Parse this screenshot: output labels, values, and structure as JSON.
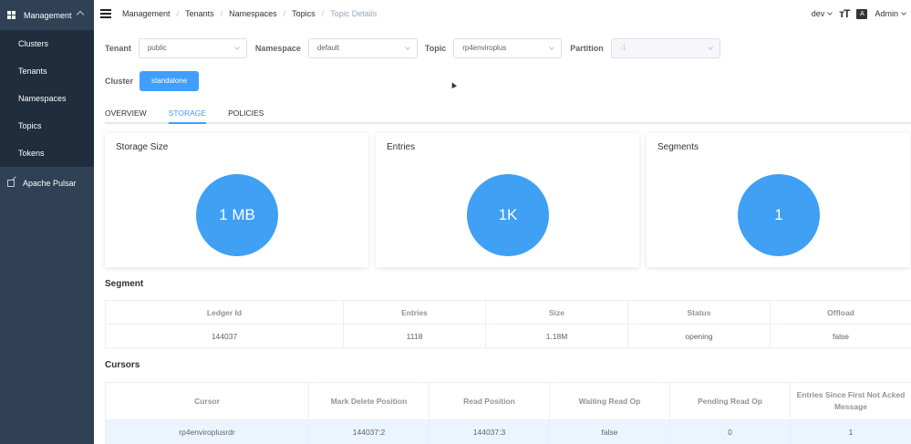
{
  "sidebar": {
    "header": "Management",
    "items": [
      {
        "label": "Clusters"
      },
      {
        "label": "Tenants"
      },
      {
        "label": "Namespaces"
      },
      {
        "label": "Topics"
      },
      {
        "label": "Tokens"
      }
    ],
    "external": "Apache Pulsar"
  },
  "topbar": {
    "breadcrumbs": [
      "Management",
      "Tenants",
      "Namespaces",
      "Topics",
      "Topic Details"
    ],
    "env": "dev",
    "user": "Admin",
    "lang_icon_text": "A"
  },
  "filters": {
    "tenant_label": "Tenant",
    "tenant_value": "public",
    "namespace_label": "Namespace",
    "namespace_value": "default",
    "topic_label": "Topic",
    "topic_value": "rp4enviroplus",
    "partition_label": "Partition",
    "partition_value": "-1",
    "cluster_label": "Cluster",
    "cluster_value": "standalone"
  },
  "tabs": [
    "OVERVIEW",
    "STORAGE",
    "POLICIES"
  ],
  "cards": [
    {
      "title": "Storage Size",
      "value": "1 MB"
    },
    {
      "title": "Entries",
      "value": "1K"
    },
    {
      "title": "Segments",
      "value": "1"
    }
  ],
  "segment": {
    "title": "Segment",
    "columns": [
      "Ledger Id",
      "Entries",
      "Size",
      "Status",
      "Offload"
    ],
    "rows": [
      [
        "144037",
        "1118",
        "1.18M",
        "opening",
        "false"
      ]
    ]
  },
  "cursors": {
    "title": "Cursors",
    "columns": [
      "Cursor",
      "Mark Delete Position",
      "Read Position",
      "Waiting Read Op",
      "Pending Read Op",
      "Entries Since First Not Acked Message"
    ],
    "rows": [
      [
        "rp4enviroplusrdr",
        "144037:2",
        "144037:3",
        "false",
        "0",
        "1"
      ]
    ]
  },
  "colors": {
    "accent": "#409eff",
    "sidebar": "#304156",
    "circle": "#3fa0f4"
  }
}
